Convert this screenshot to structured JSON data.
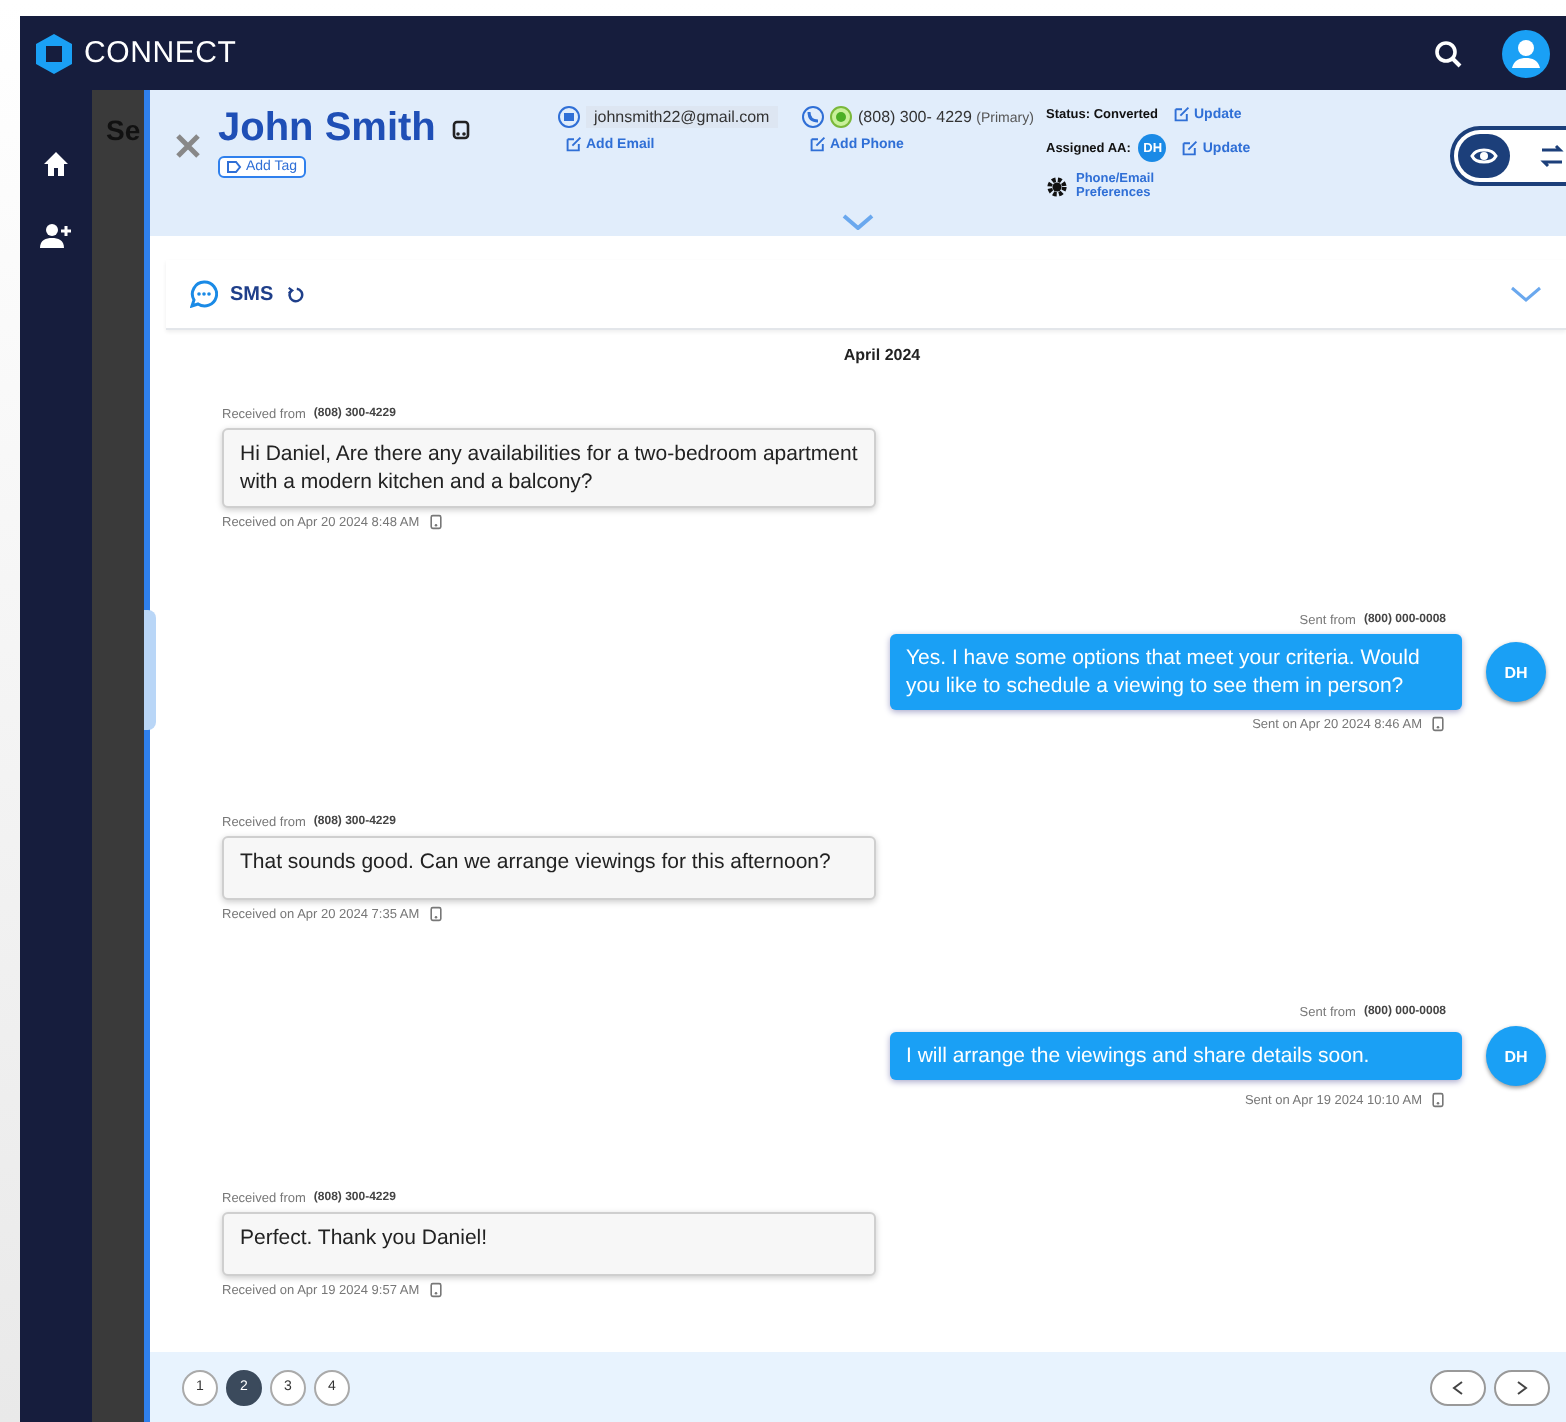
{
  "app": {
    "brand": "CONNECT"
  },
  "nav": [
    {
      "kind": "home"
    },
    {
      "kind": "add-user"
    }
  ],
  "background_panel": {
    "title": "Se"
  },
  "contact": {
    "name": "John Smith",
    "add_tag": "Add Tag",
    "email": "johnsmith22@gmail.com",
    "add_email": "Add Email",
    "phone": "(808) 300- 4229",
    "phone_note": "(Primary)",
    "add_phone": "Add Phone",
    "status_label": "Status:",
    "status": "Converted",
    "status_update": "Update",
    "assigned_label": "Assigned AA:",
    "assigned_initials": "DH",
    "assigned_update": "Update",
    "preferences": "Phone/Email Preferences"
  },
  "view_toggle": [
    {
      "kind": "eye",
      "selected": true
    },
    {
      "kind": "swap",
      "selected": false
    }
  ],
  "sms": {
    "title": "SMS",
    "date": "April 2024",
    "messages": [
      {
        "kind": "received",
        "from_label": "Received from",
        "from_number": "(808) 300-4229",
        "text": "Hi Daniel,  Are there any availabilities for a two-bedroom apartment with a modern kitchen and a balcony?",
        "footer": "Received on Apr 20 2024 8:48 AM"
      },
      {
        "kind": "sent",
        "from_label": "Sent from",
        "from_number": "(800) 000-0008",
        "text": "Yes. I have some options that meet your criteria. Would you like to schedule a viewing to see them in person?",
        "footer": "Sent on Apr 20 2024 8:46 AM",
        "initials": "DH"
      },
      {
        "kind": "received",
        "from_label": "Received from",
        "from_number": "(808) 300-4229",
        "text": "That sounds good. Can we arrange viewings for this afternoon?",
        "footer": "Received on Apr 20 2024 7:35 AM"
      },
      {
        "kind": "sent",
        "from_label": "Sent from",
        "from_number": "(800) 000-0008",
        "text": "I will arrange the viewings and share details soon.",
        "footer": "Sent on Apr 19 2024 10:10 AM",
        "initials": "DH"
      },
      {
        "kind": "received",
        "from_label": "Received from",
        "from_number": "(808) 300-4229",
        "text": "Perfect. Thank you Daniel!",
        "footer": "Received on Apr 19 2024 9:57 AM"
      }
    ]
  },
  "pagination": {
    "pages": [
      {
        "label": "1",
        "selected": false
      },
      {
        "label": "2",
        "selected": true
      },
      {
        "label": "3",
        "selected": false
      },
      {
        "label": "4",
        "selected": false
      }
    ]
  }
}
